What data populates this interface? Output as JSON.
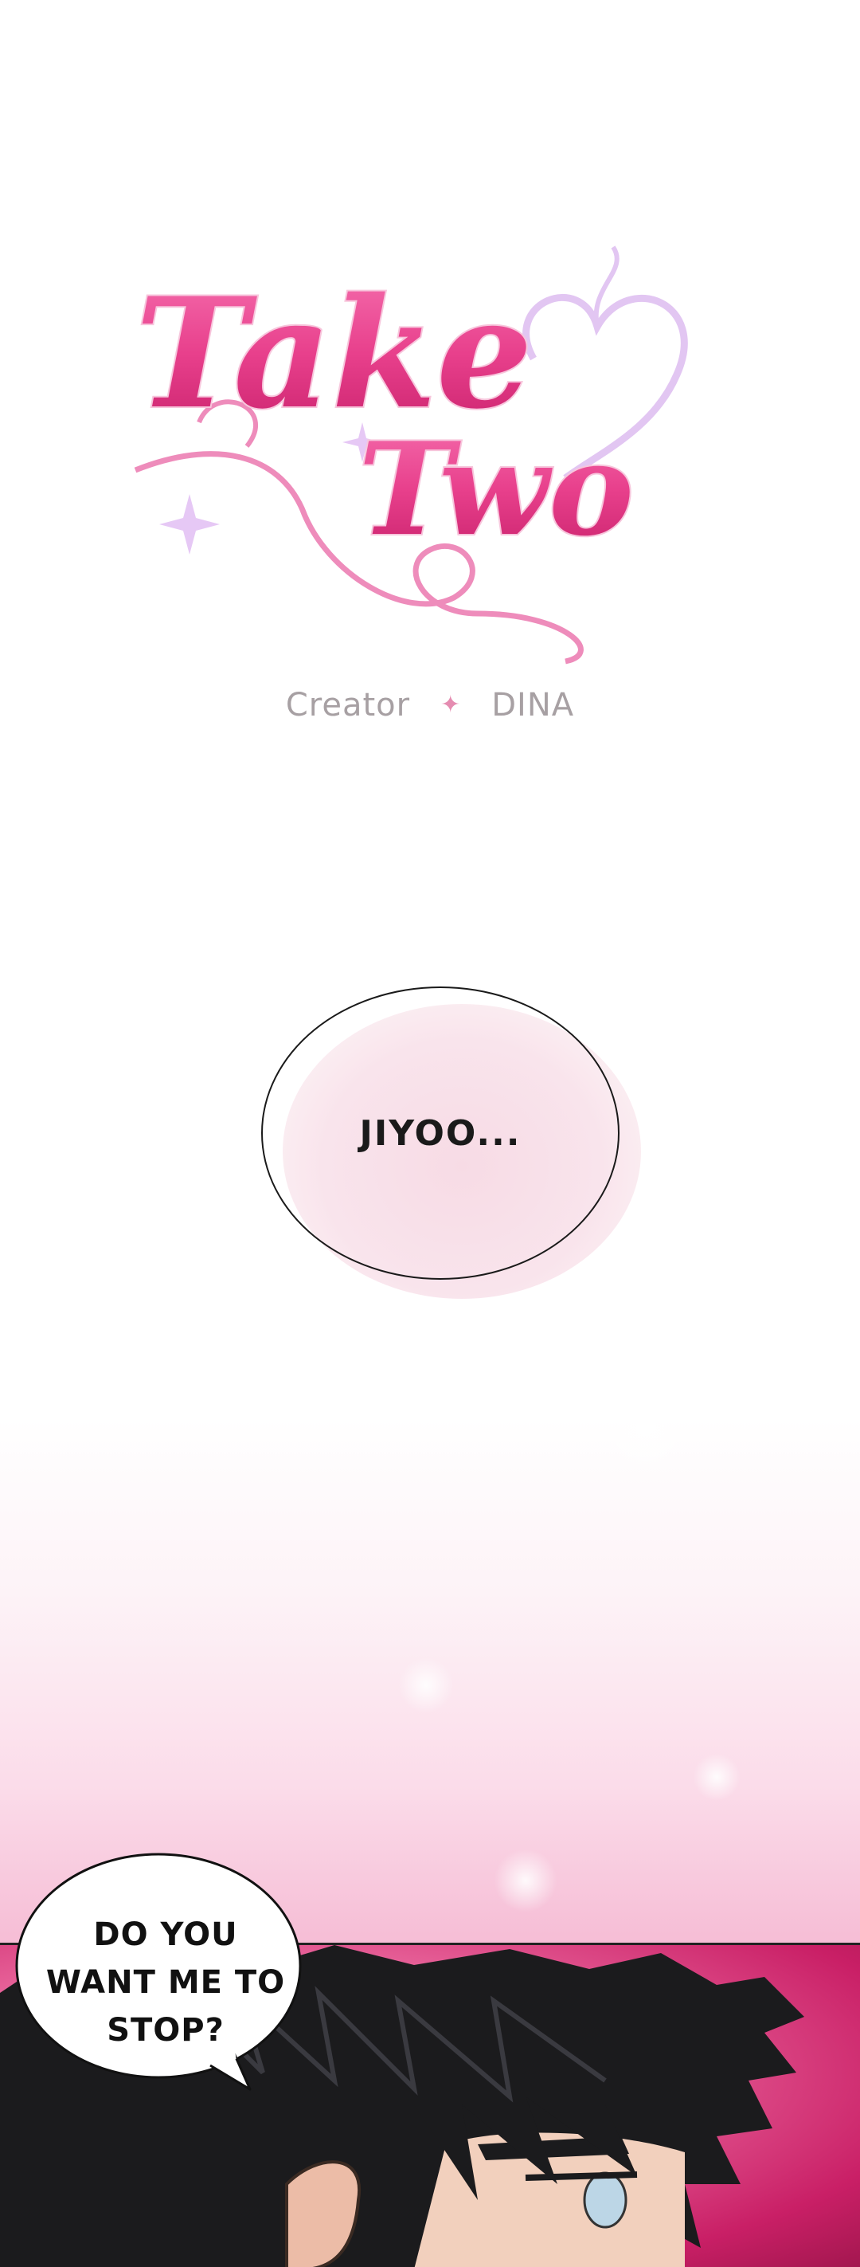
{
  "title": {
    "line1": "Take",
    "line2": "Two"
  },
  "credit": {
    "label": "Creator",
    "separator": "✦",
    "name": "DINA"
  },
  "bubbles": [
    {
      "text": "JIYOO..."
    },
    {
      "lines": [
        "DO YOU",
        "WANT ME TO",
        "STOP?"
      ]
    }
  ],
  "colors": {
    "title_pink": "#e8408c",
    "title_outline": "#f7c6dc",
    "accent_lilac": "#e2c6f2",
    "panel_magenta": "#c91f66"
  }
}
